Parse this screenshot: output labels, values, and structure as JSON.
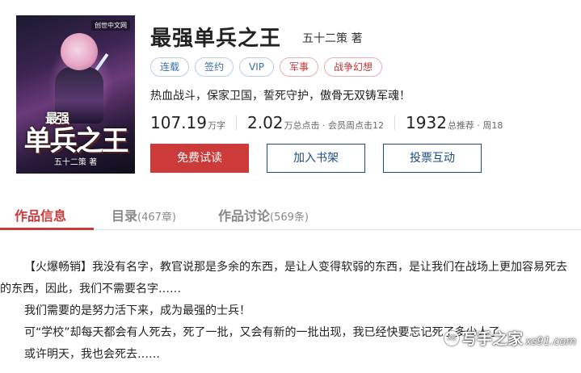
{
  "book": {
    "title": "最强单兵之王",
    "author": "五十二策 著",
    "tags": [
      {
        "label": "连载",
        "color": "#3a6ea5"
      },
      {
        "label": "签约",
        "color": "#3a6ea5"
      },
      {
        "label": "VIP",
        "color": "#3a6ea5"
      },
      {
        "label": "军事",
        "color": "#c83636"
      },
      {
        "label": "战争幻想",
        "color": "#c83636"
      }
    ],
    "intro": "热血战斗，保家卫国，誓死守护，傲骨无双铸军魂！",
    "stats": [
      {
        "value": "107.19",
        "unit": "万字"
      },
      {
        "value": "2.02",
        "unit": "万总点击 · 会员周点击12"
      },
      {
        "value": "1932",
        "unit": "总推荐 · 周18"
      }
    ],
    "cover": {
      "title_small": "最强",
      "title_large": "单兵之王",
      "author": "五十二策 著",
      "brand": "创世中文网"
    }
  },
  "actions": {
    "read_label": "免费试读",
    "shelf_label": "加入书架",
    "vote_label": "投票互动"
  },
  "tabs": [
    {
      "label": "作品信息",
      "count": "",
      "active": true
    },
    {
      "label": "目录",
      "count": "(467章)",
      "active": false
    },
    {
      "label": "作品讨论",
      "count": "(569条)",
      "active": false
    }
  ],
  "content": {
    "lines": [
      "【火爆畅销】我没有名字，教官说那是多余的东西，是让人变得软弱的东西，是让我们在战场上更加容易死去",
      "的东西，因此，我们不需要名字……",
      "我们需要的是努力活下来，成为最强的士兵！",
      "可“学校”却每天都会有人死去，死了一批，又会有新的一批出现，我已经快要忘记死了多少人了……",
      "或许明天，我也会死去……"
    ]
  },
  "watermark": {
    "logo": "XS",
    "name": "写手之家",
    "url": "xs91.com"
  },
  "colors": {
    "accent_red": "#cc3a3a",
    "link_blue": "#1c4c80",
    "tag_blue": "#3a6ea5"
  }
}
